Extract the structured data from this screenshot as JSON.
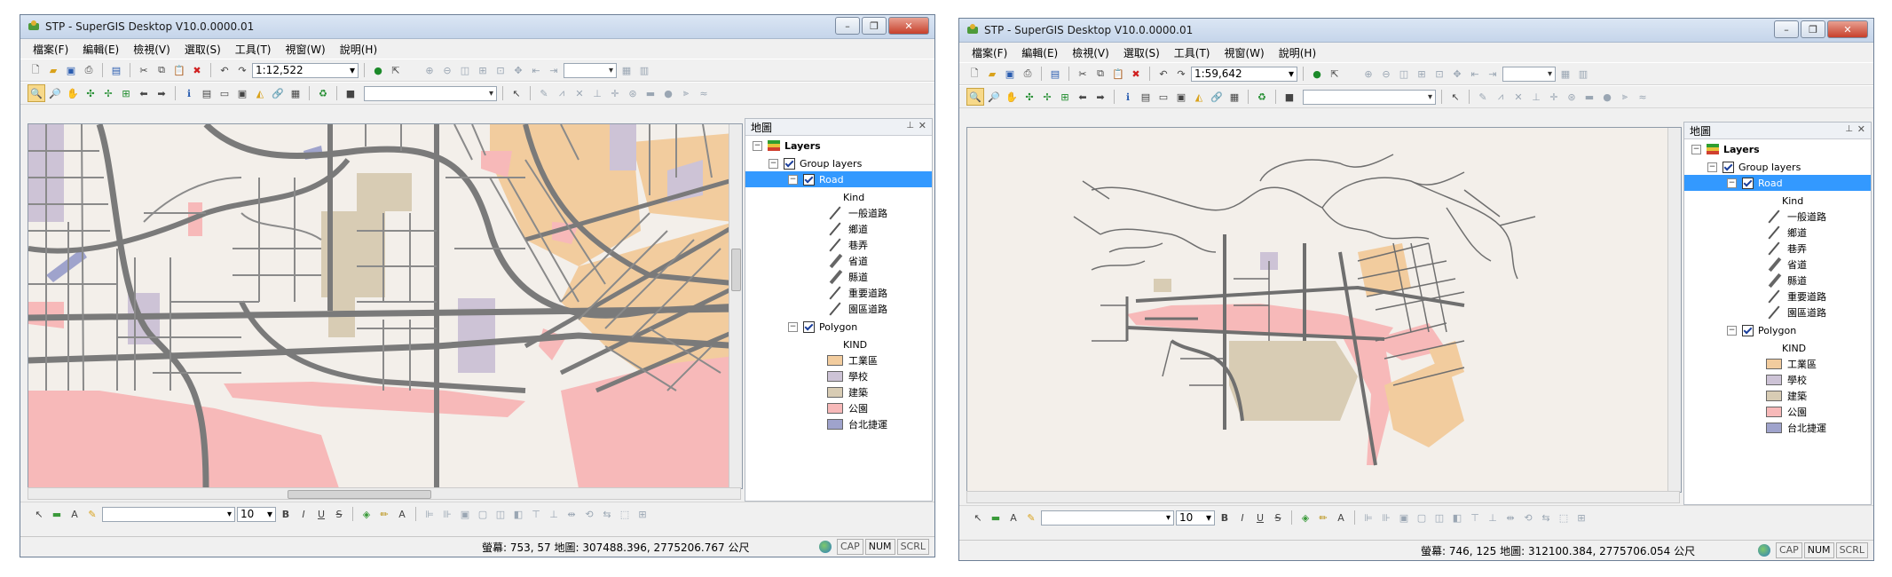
{
  "windows": [
    {
      "title": "STP - SuperGIS Desktop V10.0.0000.01",
      "menu": [
        "檔案(F)",
        "編輯(E)",
        "檢視(V)",
        "選取(S)",
        "工具(T)",
        "視窗(W)",
        "說明(H)"
      ],
      "scale": "1:12,522",
      "panel_title": "地圖",
      "tree": {
        "root": "Layers",
        "group": "Group layers",
        "road_layer": "Road",
        "road_field": "Kind",
        "road_kinds": [
          "一般道路",
          "鄉道",
          "巷弄",
          "省道",
          "縣道",
          "重要道路",
          "園區道路"
        ],
        "polygon_layer": "Polygon",
        "polygon_field": "KIND",
        "polygon_kinds": [
          "工業區",
          "學校",
          "建築",
          "公園",
          "台北捷運"
        ]
      },
      "font_size": "10",
      "status": "螢幕: 753, 57  地圖: 307488.396, 2775206.767 公尺",
      "indicators": [
        "CAP",
        "NUM",
        "SCRL"
      ]
    },
    {
      "title": "STP - SuperGIS Desktop V10.0.0000.01",
      "menu": [
        "檔案(F)",
        "編輯(E)",
        "檢視(V)",
        "選取(S)",
        "工具(T)",
        "視窗(W)",
        "說明(H)"
      ],
      "scale": "1:59,642",
      "panel_title": "地圖",
      "tree": {
        "root": "Layers",
        "group": "Group layers",
        "road_layer": "Road",
        "road_field": "Kind",
        "road_kinds": [
          "一般道路",
          "鄉道",
          "巷弄",
          "省道",
          "縣道",
          "重要道路",
          "園區道路"
        ],
        "polygon_layer": "Polygon",
        "polygon_field": "KIND",
        "polygon_kinds": [
          "工業區",
          "學校",
          "建築",
          "公園",
          "台北捷運"
        ]
      },
      "font_size": "10",
      "status": "螢幕: 746, 125  地圖: 312100.384, 2775706.054 公尺",
      "indicators": [
        "CAP",
        "NUM",
        "SCRL"
      ]
    }
  ],
  "colors": {
    "industrial": "#f2cc9e",
    "school": "#cdc3d6",
    "building": "#d8ccb4",
    "park": "#f7b9b9",
    "metro": "#9fa3cc",
    "road": "#7a7a7a",
    "map_bg": "#f3efea"
  }
}
